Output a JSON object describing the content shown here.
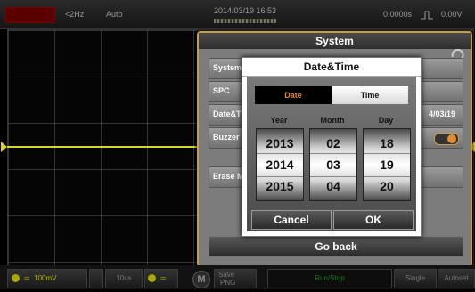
{
  "topbar": {
    "freq": "<2Hz",
    "mode": "Auto",
    "datetime": "2014/03/19  16:53",
    "timebase": "0.0000s",
    "trigger_level": "0.00V"
  },
  "system_panel": {
    "title": "System",
    "rows": {
      "system": "System",
      "spc": "SPC",
      "datetime": "Date&T",
      "buzzer": "Buzzer",
      "erase": "Erase M"
    },
    "date_value": "4/03/19",
    "go_back": "Go back"
  },
  "dialog": {
    "title": "Date&Time",
    "tab_date": "Date",
    "tab_time": "Time",
    "col_year": "Year",
    "col_month": "Month",
    "col_day": "Day",
    "year": {
      "prev": "2013",
      "cur": "2014",
      "next": "2015"
    },
    "month": {
      "prev": "02",
      "cur": "03",
      "next": "04"
    },
    "day": {
      "prev": "18",
      "cur": "19",
      "next": "20"
    },
    "cancel": "Cancel",
    "ok": "OK"
  },
  "bottombar": {
    "ch1": "100mV",
    "time": "10us",
    "m": "M",
    "save": "Save",
    "png": "PNG",
    "runstop": "Run/Stop",
    "single": "Single",
    "autoset": "Autoset"
  },
  "colors": {
    "accent_orange": "#c99d45",
    "trace_yellow": "#d6d62a",
    "date_tab_text": "#e28c2b",
    "runstop_green": "#1a7a1a"
  }
}
